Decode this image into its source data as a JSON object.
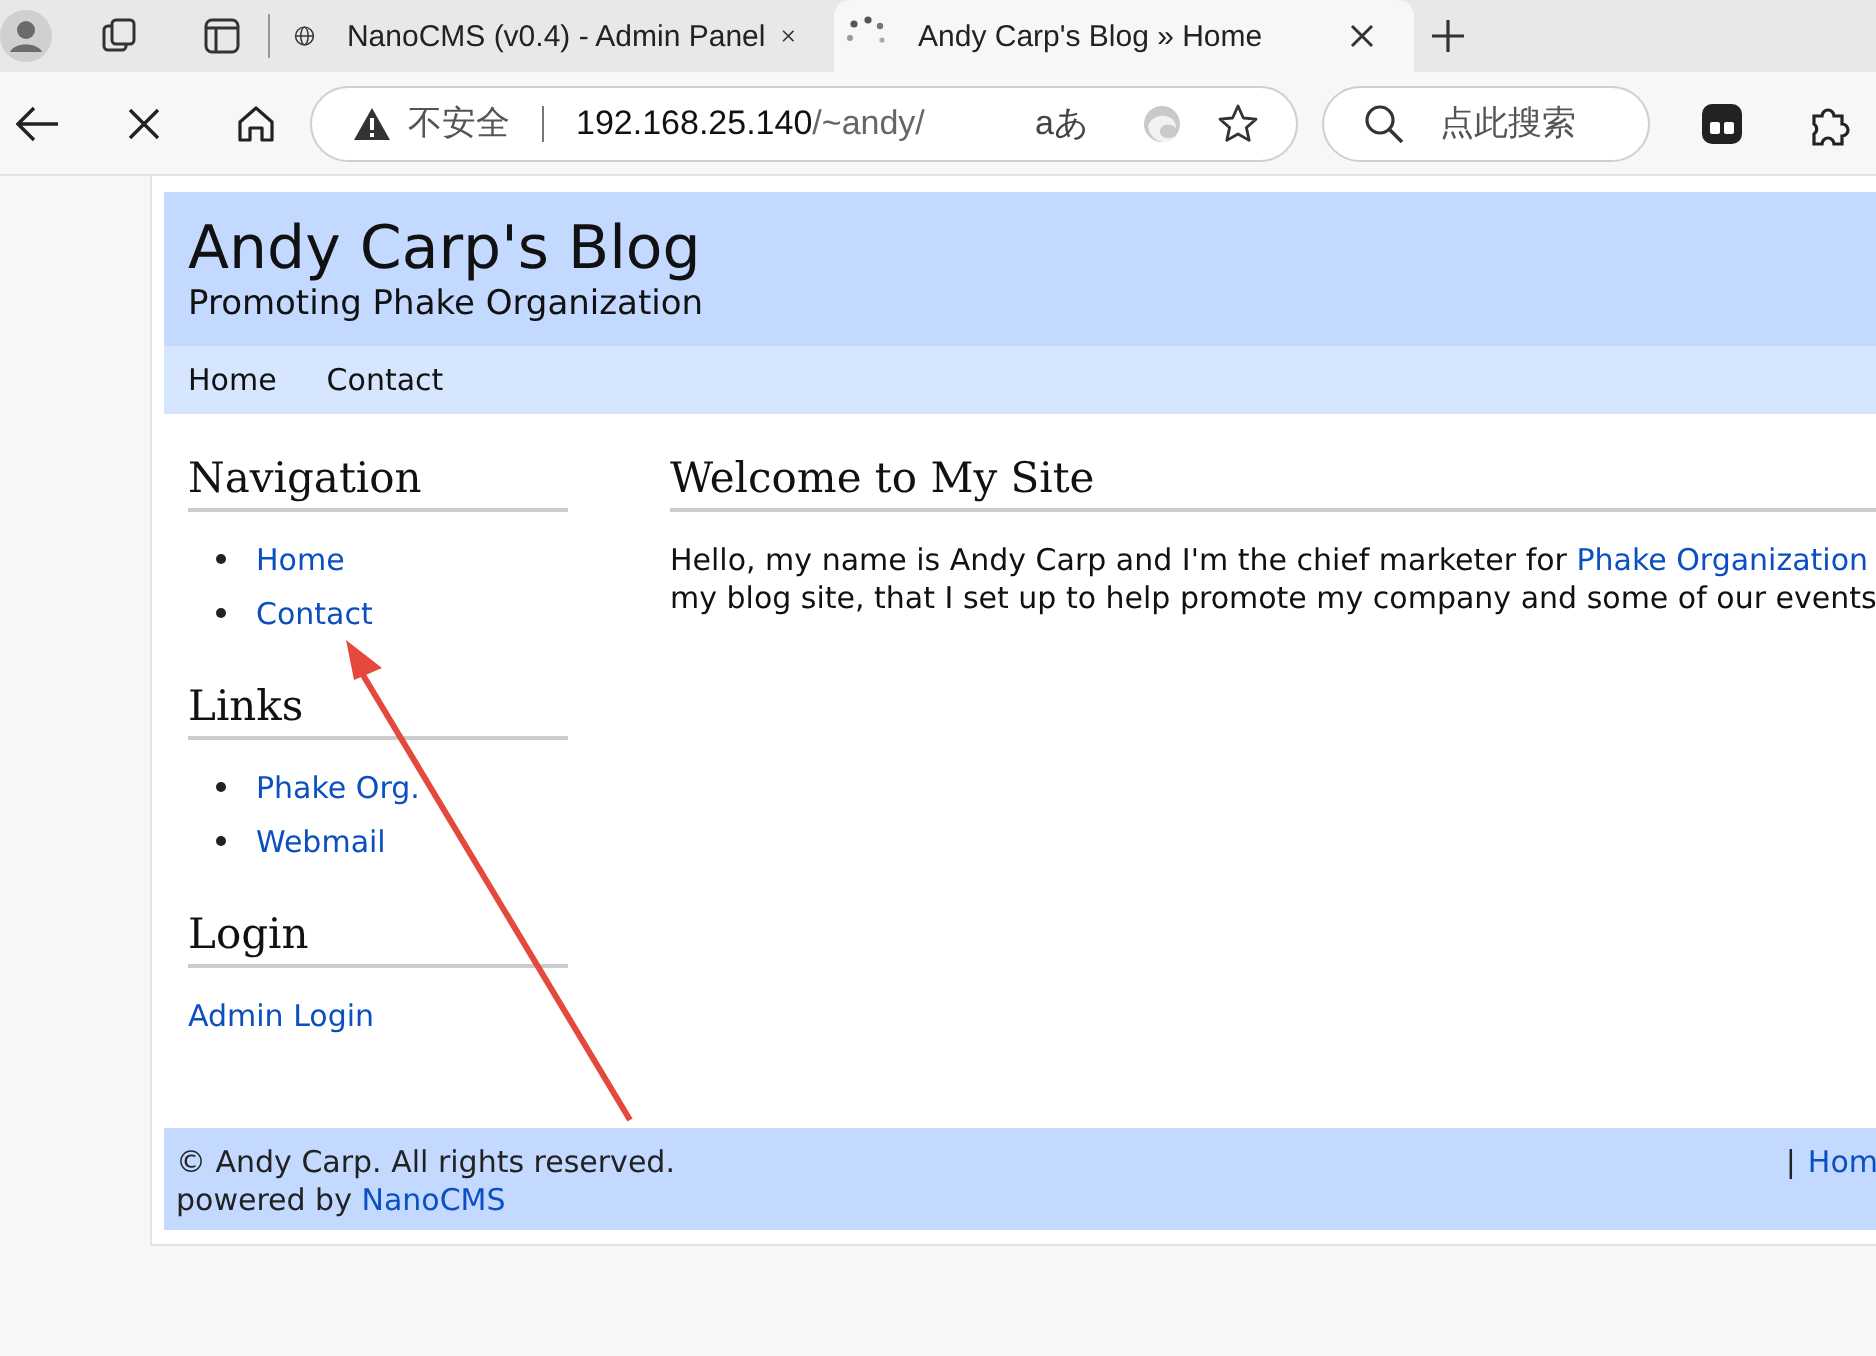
{
  "browser": {
    "tabs": [
      {
        "title": "NanoCMS (v0.4) - Admin Panel",
        "selected": false,
        "loading": false
      },
      {
        "title": "Andy Carp's Blog » Home",
        "selected": true,
        "loading": true
      }
    ],
    "security_label": "不安全",
    "url_host": "192.168.25.140",
    "url_path": "/~andy/",
    "reader_glyph": "aあ",
    "search_placeholder": "点此搜索"
  },
  "site": {
    "title": "Andy Carp's Blog",
    "tagline": "Promoting Phake Organization",
    "nav": [
      {
        "label": "Home"
      },
      {
        "label": "Contact"
      }
    ],
    "sidebar": [
      {
        "heading": "Navigation",
        "kind": "list",
        "items": [
          "Home",
          "Contact"
        ]
      },
      {
        "heading": "Links",
        "kind": "list",
        "items": [
          "Phake Org.",
          "Webmail"
        ]
      },
      {
        "heading": "Login",
        "kind": "plain",
        "items": [
          "Admin Login"
        ]
      }
    ],
    "main": {
      "heading": "Welcome to My Site",
      "lines": [
        {
          "text": "Hello, my name is Andy Carp and I'm the chief marketer for ",
          "link": "Phake Organization"
        },
        {
          "text": "my blog site, that I set up to help promote my company and some of our events"
        }
      ]
    },
    "footer": {
      "copyright": "© Andy Carp. All rights reserved.",
      "powered_text": "powered by ",
      "powered_link": "NanoCMS",
      "right_separator": "|",
      "right_link": "Hom"
    }
  },
  "annotation": {
    "kind": "arrow"
  }
}
